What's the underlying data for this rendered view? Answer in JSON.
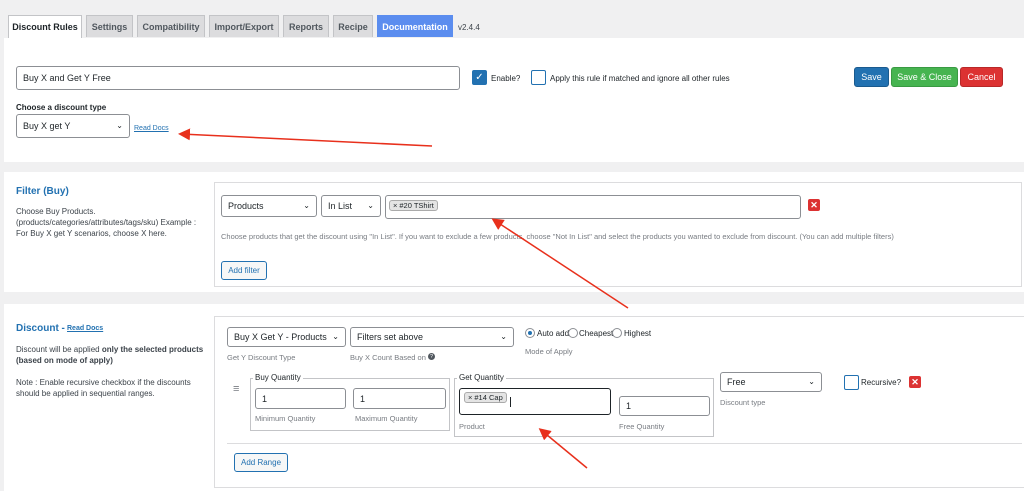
{
  "tabs": [
    {
      "label": "Discount Rules"
    },
    {
      "label": "Settings"
    },
    {
      "label": "Compatibility"
    },
    {
      "label": "Import/Export"
    },
    {
      "label": "Reports"
    },
    {
      "label": "Recipe"
    },
    {
      "label": "Documentation"
    }
  ],
  "version": "v2.4.4",
  "rule": {
    "title_value": "Buy X and Get Y Free",
    "enable_label": "Enable?",
    "enable_checked": true,
    "exclusive_label": "Apply this rule if matched and ignore all other rules",
    "save_label": "Save",
    "save_close_label": "Save & Close",
    "cancel_label": "Cancel",
    "discount_type_heading": "Choose a discount type",
    "discount_type_value": "Buy X get Y",
    "read_docs": "Read Docs"
  },
  "filter": {
    "title": "Filter (Buy)",
    "desc_line1": "Choose Buy Products.",
    "desc_line2": "(products/categories/attributes/tags/sku) Example :",
    "desc_line3": "For Buy X get Y scenarios, choose X here.",
    "type_value": "Products",
    "operator_value": "In List",
    "product_tag": "#20 TShirt",
    "help": "Choose products that get the discount using \"In List\". If you want to exclude a few products, choose \"Not In List\" and select the products you wanted to exclude from discount. (You can add multiple filters)",
    "add_filter_label": "Add filter"
  },
  "discount": {
    "title": "Discount -",
    "read_docs": "Read Docs",
    "desc_pre": "Discount will be applied ",
    "desc_bold": "only the selected products",
    "desc_bold2": "(based on mode of apply)",
    "note_line1": "Note : Enable recursive checkbox if the discounts",
    "note_line2": "should be applied in sequential ranges.",
    "get_y_type_value": "Buy X Get Y - Products",
    "get_y_type_label": "Get Y Discount Type",
    "count_based_value": "Filters set above",
    "count_based_label": "Buy X Count Based on",
    "mode": {
      "options": [
        "Auto add",
        "Cheapest",
        "Highest"
      ],
      "selected": "Auto add",
      "label": "Mode of Apply"
    },
    "buy_quantity_legend": "Buy Quantity",
    "min_qty_value": "1",
    "min_qty_label": "Minimum Quantity",
    "max_qty_value": "1",
    "max_qty_label": "Maximum Quantity",
    "get_quantity_legend": "Get Quantity",
    "get_product_tag": "#14 Cap",
    "product_label": "Product",
    "free_qty_value": "1",
    "free_qty_label": "Free Quantity",
    "discount_type_value": "Free",
    "discount_type_label": "Discount type",
    "recursive_label": "Recursive?",
    "add_range_label": "Add Range"
  },
  "icons": {
    "chevron": "chevron-down-icon",
    "delete": "delete-icon",
    "help": "help-circle-icon",
    "drag": "drag-handle-icon",
    "annotation": "red-arrow"
  },
  "colors": {
    "primary": "#2271b1",
    "success": "#46b450",
    "danger": "#dc3232",
    "arrow": "#e8301c"
  }
}
